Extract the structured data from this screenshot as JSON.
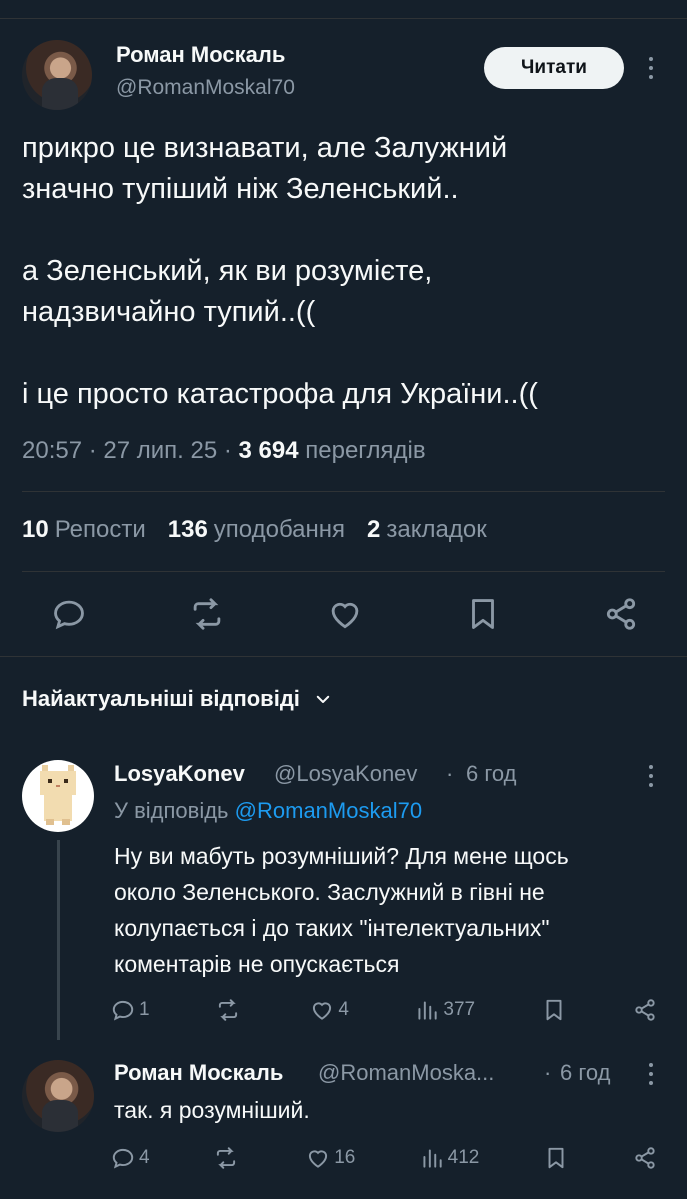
{
  "tweet": {
    "author_name": "Роман Москаль",
    "author_handle": "@RomanMoskal70",
    "follow_label": "Читати",
    "paragraphs": [
      "прикро це визнавати, але Залужний\nзначно тупіший ніж Зеленський..",
      "а Зеленський, як ви розумієте,\nнадзвичайно тупий..((",
      "і це просто катастрофа для України..(("
    ],
    "time": "20:57",
    "date": "27 лип. 25",
    "views_count": "3 694",
    "views_label": "переглядів",
    "reposts_count": "10",
    "reposts_label": "Репости",
    "likes_count": "136",
    "likes_label": "уподобання",
    "bookmarks_count": "2",
    "bookmarks_label": "закладок"
  },
  "replies_header": "Найактуальніші відповіді",
  "replies": [
    {
      "name": "LosyaKonev",
      "handle": "@LosyaKonev",
      "time": "6 год",
      "reply_to_prefix": "У відповідь",
      "reply_to_handle": "@RomanMoskal70",
      "text": "Ну ви мабуть розумніший? Для мене щось\nоколо Зеленського. Заслужний в гівні не\nколупається і до таких \"інтелектуальних\"\nкоментарів не опускається",
      "replies": "1",
      "reposts": "",
      "likes": "4",
      "views": "377"
    },
    {
      "name": "Роман Москаль",
      "handle": "@RomanMoska...",
      "time": "6 год",
      "text": "так. я розумніший.",
      "replies": "4",
      "reposts": "",
      "likes": "16",
      "views": "412"
    }
  ],
  "colors": {
    "background": "#15202b",
    "text": "#f7f9f9",
    "muted": "#8b98a5",
    "link": "#1d9bf0",
    "divider": "#2f3336"
  }
}
